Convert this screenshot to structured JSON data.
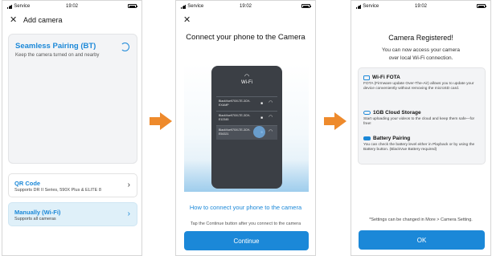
{
  "colors": {
    "accent": "#1b88d8",
    "arrow": "#ee8a2c",
    "card_bg": "#f3f4f6",
    "selected_bg": "#dff0f9"
  },
  "statusbar": {
    "carrier": "Service",
    "time": "19:02"
  },
  "screen1": {
    "title": "Add camera",
    "close_icon": "close-icon",
    "bt_card": {
      "title": "Seamless Pairing (BT)",
      "subtitle": "Keep the camera turned on and nearby"
    },
    "qr": {
      "title": "QR Code",
      "subtitle": "Supports DR II Series, 590X Plus & ELITE 8"
    },
    "wifi": {
      "title": "Manually (Wi-Fi)",
      "subtitle": "Supports all cameras"
    }
  },
  "screen2": {
    "title": "Connect your phone to the Camera",
    "mock": {
      "header": "Wi-Fi",
      "networks": [
        {
          "name": "BlackVue970XLTE-3CH-EXAMP"
        },
        {
          "name": "BlackVue970XLTE-3CH-E12345"
        },
        {
          "name": "BlackVue970XLTE-3CH-E54321"
        }
      ]
    },
    "howto": "How to connect your phone to the camera",
    "hint": "Tap the Continue button after you connect to the camera",
    "continue": "Continue"
  },
  "screen3": {
    "title": "Camera Registered!",
    "subtitle_line1": "You can now access your camera",
    "subtitle_line2": "over local Wi-Fi connection.",
    "features": [
      {
        "title": "Wi-Fi FOTA",
        "desc": "FOTA (Firmware update Over-The-Air) allows you to update your device conveniently without removing the microSD card.",
        "icon": "wifi-fota-icon"
      },
      {
        "title": "1GB Cloud Storage",
        "desc": "Start uploading your videos to the cloud and keep them safe—for free!",
        "icon": "cloud-icon"
      },
      {
        "title": "Battery Pairing",
        "desc": "You can check the battery level either in Playback or by using the Battery button. (BlackVue Battery required)",
        "icon": "battery-icon"
      }
    ],
    "note": "*Settings can be changed in More > Camera Setting.",
    "ok": "OK"
  }
}
